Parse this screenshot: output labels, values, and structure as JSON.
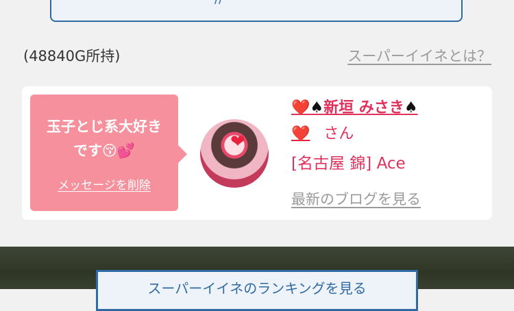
{
  "points_text": "(48840G所持)",
  "help_link": "スーパーイイネとは？",
  "card": {
    "bubble_message_line1": "玉子とじ系大好き",
    "bubble_message_line2": "です😚💕",
    "delete_message": "メッセージを削除",
    "name_prefix_heart": "❤️",
    "name_prefix_spade": "♠",
    "name": "新垣 みさき",
    "name_suffix_spade": "♠",
    "name_second_heart": "❤️",
    "honorific": "さん",
    "shop": "[名古屋 錦] Ace",
    "blog_link": "最新のブログを見る"
  },
  "ranking_button": "スーパーイイネのランキングを見る",
  "top_box_partial": "//"
}
